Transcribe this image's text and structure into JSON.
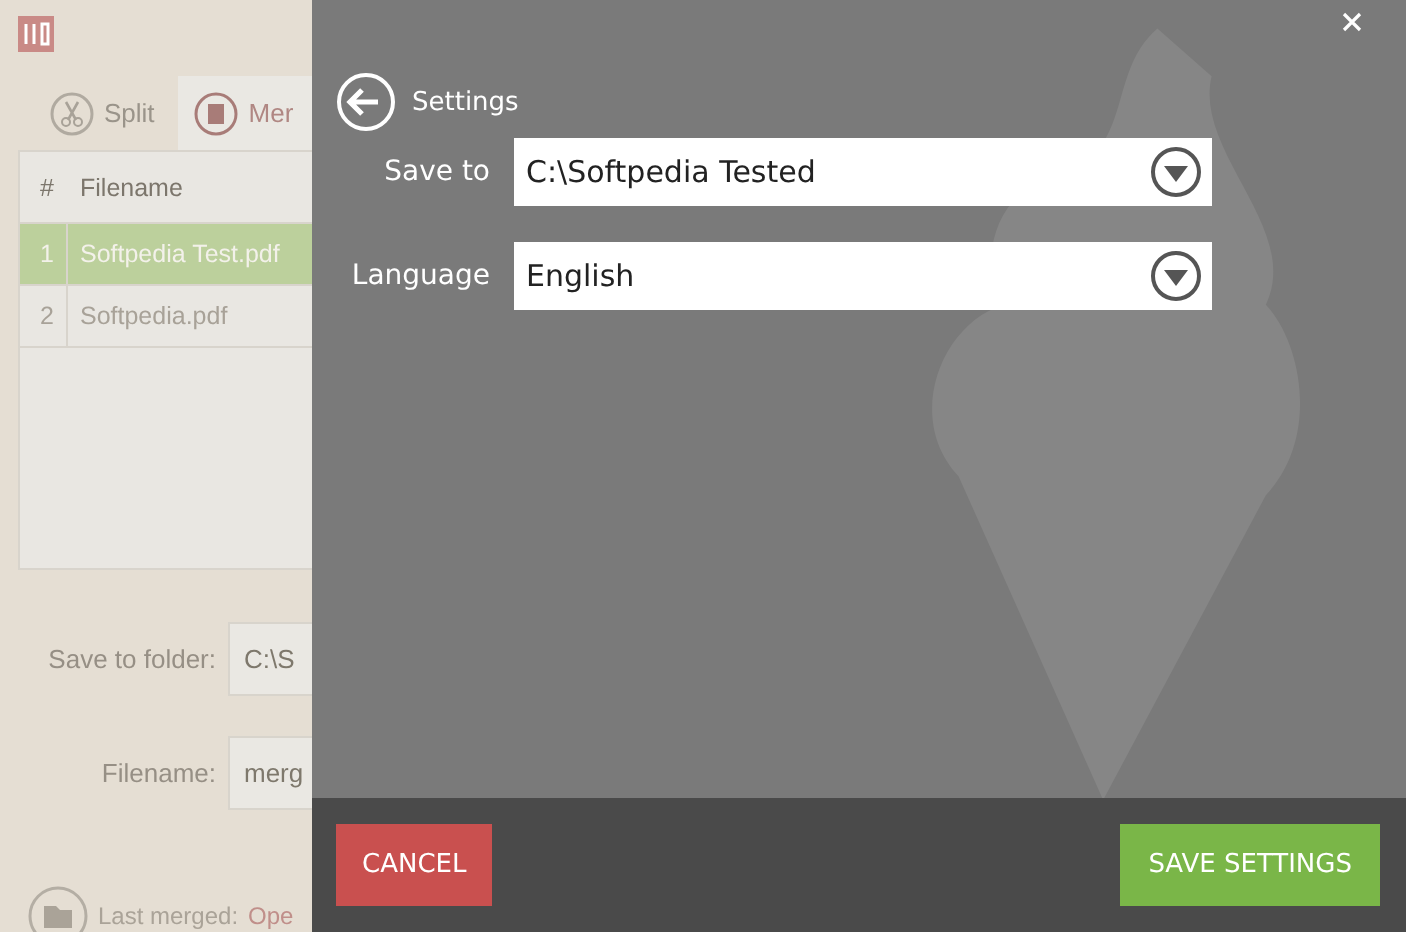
{
  "app": {
    "tabs": [
      {
        "label": "Split",
        "selected": false
      },
      {
        "label": "Mer",
        "selected": true
      }
    ],
    "table": {
      "columns": [
        "#",
        "Filename"
      ],
      "rows": [
        {
          "index": "1",
          "filename": "Softpedia Test.pdf",
          "selected": true
        },
        {
          "index": "2",
          "filename": "Softpedia.pdf",
          "selected": false
        }
      ]
    },
    "save_to_folder": {
      "label": "Save to folder:",
      "value": "C:\\S"
    },
    "filename": {
      "label": "Filename:",
      "value": "merg"
    },
    "status": {
      "text": "Last merged:",
      "link": "Ope"
    }
  },
  "settings": {
    "title": "Settings",
    "fields": [
      {
        "label": "Save to",
        "value": "C:\\Softpedia Tested"
      },
      {
        "label": "Language",
        "value": "English"
      }
    ],
    "buttons": [
      {
        "label": "CANCEL",
        "kind": "cancel"
      },
      {
        "label": "SAVE SETTINGS",
        "kind": "save"
      }
    ]
  }
}
